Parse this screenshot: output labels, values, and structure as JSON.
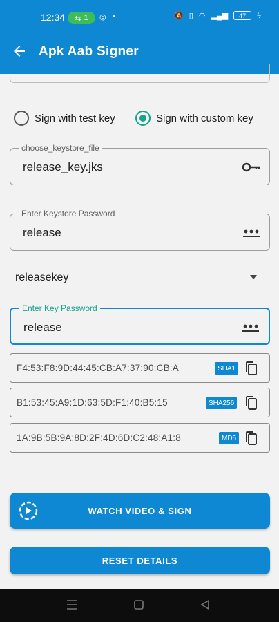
{
  "status_bar": {
    "time": "12:34",
    "pill_count": "1",
    "battery": "47"
  },
  "app_bar": {
    "title": "Apk Aab Signer"
  },
  "signing_options": {
    "test_key_label": "Sign with test key",
    "custom_key_label": "Sign with custom key",
    "selected": "custom"
  },
  "keystore_file": {
    "label": "choose_keystore_file",
    "value": "release_key.jks",
    "icon": "key-icon"
  },
  "keystore_password": {
    "label": "Enter Keystore Password",
    "value": "release",
    "icon": "dots-icon"
  },
  "alias_dropdown": {
    "value": "releasekey"
  },
  "key_password": {
    "label": "Enter Key Password",
    "value": "release",
    "icon": "dots-icon"
  },
  "hashes": [
    {
      "value": "F4:53:F8:9D:44:45:CB:A7:37:90:CB:A",
      "type": "SHA1"
    },
    {
      "value": "B1:53:45:A9:1D:63:5D:F1:40:B5:15",
      "type": "SHA256"
    },
    {
      "value": "1A:9B:5B:9A:8D:2F:4D:6D:C2:48:A1:8",
      "type": "MD5"
    }
  ],
  "actions": {
    "watch_sign_label": "WATCH VIDEO & SIGN",
    "reset_label": "RESET DETAILS"
  },
  "colors": {
    "primary": "#0f88d4",
    "accent": "#1aa38b",
    "background": "#f2f2f2"
  }
}
